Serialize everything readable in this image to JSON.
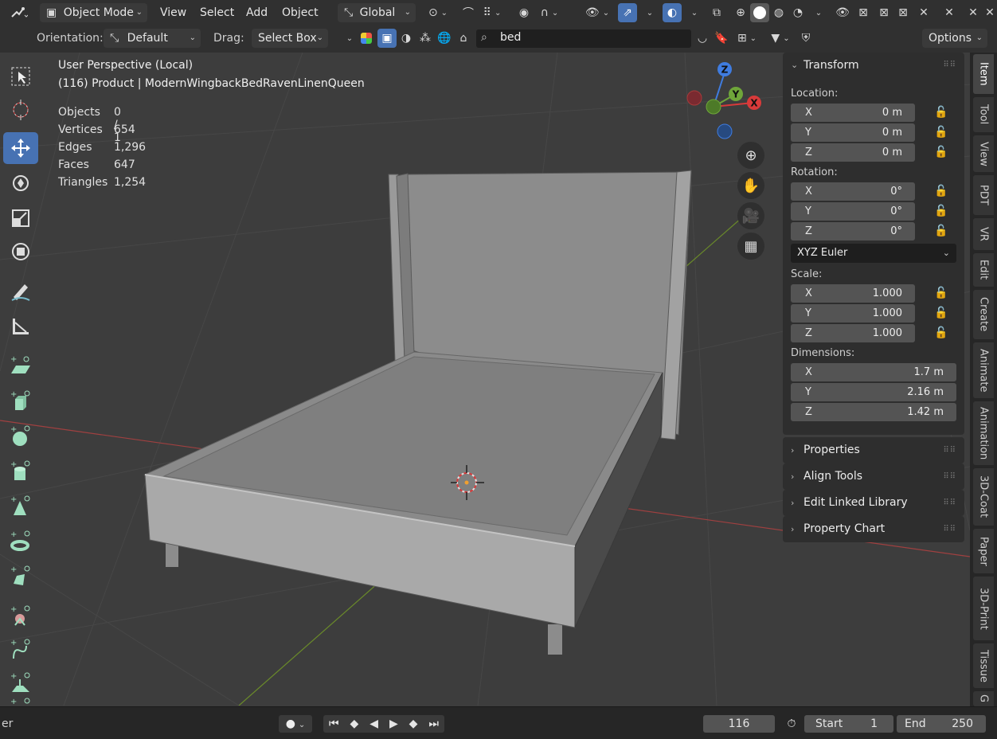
{
  "header": {
    "mode_label": "Object Mode",
    "menus": [
      "View",
      "Select",
      "Add",
      "Object"
    ],
    "transform_orientation": "Global"
  },
  "toolsettings": {
    "orientation_label": "Orientation:",
    "orientation_value": "Default",
    "drag_label": "Drag:",
    "drag_value": "Select Box",
    "search_value": "bed",
    "options_label": "Options"
  },
  "viewport": {
    "view_name": "User Perspective (Local)",
    "object_name": "(116) Product | ModernWingbackBedRavenLinenQueen",
    "stats": [
      {
        "label": "Objects",
        "value": "0 / 1"
      },
      {
        "label": "Vertices",
        "value": "654"
      },
      {
        "label": "Edges",
        "value": "1,296"
      },
      {
        "label": "Faces",
        "value": "647"
      },
      {
        "label": "Triangles",
        "value": "1,254"
      }
    ],
    "gizmo": {
      "x": "X",
      "y": "Y",
      "z": "Z"
    }
  },
  "npanel": {
    "transform_title": "Transform",
    "location_label": "Location:",
    "location": [
      {
        "axis": "X",
        "value": "0 m"
      },
      {
        "axis": "Y",
        "value": "0 m"
      },
      {
        "axis": "Z",
        "value": "0 m"
      }
    ],
    "rotation_label": "Rotation:",
    "rotation": [
      {
        "axis": "X",
        "value": "0°"
      },
      {
        "axis": "Y",
        "value": "0°"
      },
      {
        "axis": "Z",
        "value": "0°"
      }
    ],
    "rotation_mode": "XYZ Euler",
    "scale_label": "Scale:",
    "scale": [
      {
        "axis": "X",
        "value": "1.000"
      },
      {
        "axis": "Y",
        "value": "1.000"
      },
      {
        "axis": "Z",
        "value": "1.000"
      }
    ],
    "dimensions_label": "Dimensions:",
    "dimensions": [
      {
        "axis": "X",
        "value": "1.7 m"
      },
      {
        "axis": "Y",
        "value": "2.16 m"
      },
      {
        "axis": "Z",
        "value": "1.42 m"
      }
    ],
    "collapsed_panels": [
      "Properties",
      "Align Tools",
      "Edit Linked Library",
      "Property Chart"
    ]
  },
  "sidetabs": [
    "Item",
    "Tool",
    "View",
    "PDT",
    "VR",
    "Edit",
    "Create",
    "Animate",
    "Animation",
    "3D-Coat",
    "Paper",
    "3D-Print",
    "Tissue",
    "G"
  ],
  "timeline": {
    "status_text": "er",
    "current_frame": "116",
    "start_label": "Start",
    "start_value": "1",
    "end_label": "End",
    "end_value": "250"
  }
}
